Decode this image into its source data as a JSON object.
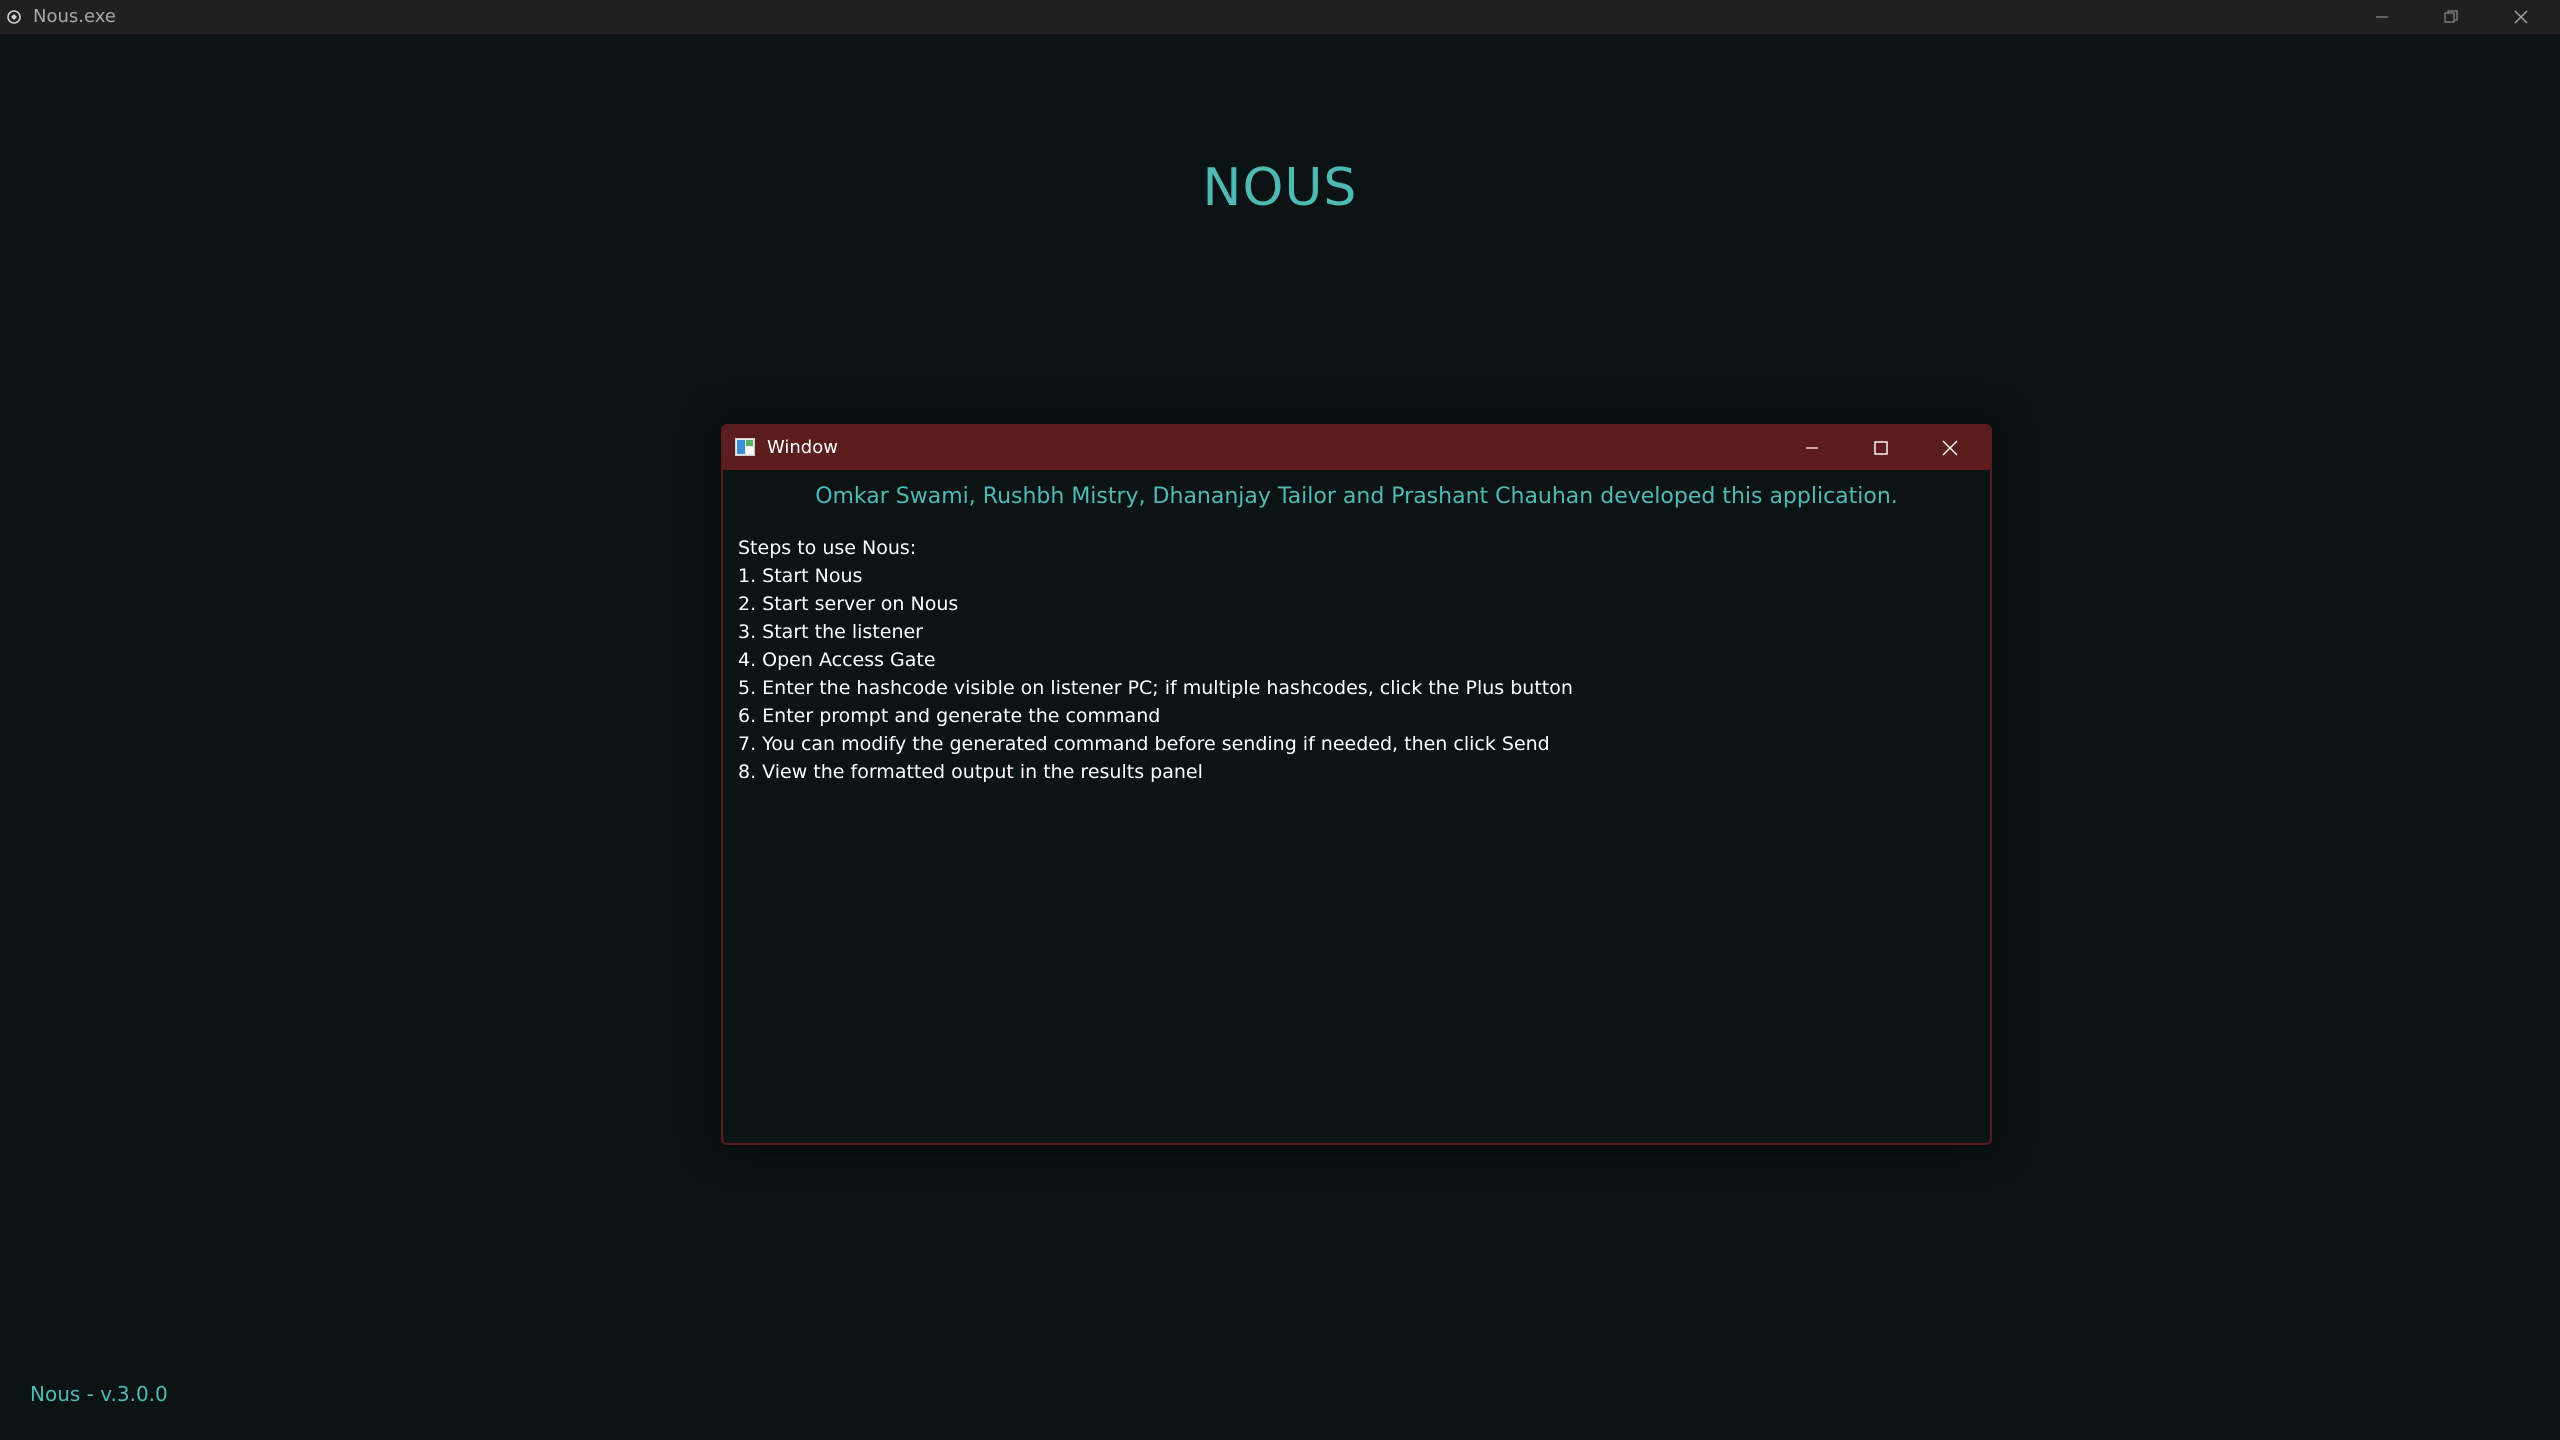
{
  "app_window": {
    "title": "Nous.exe",
    "controls": [
      "minimize",
      "restore",
      "close"
    ]
  },
  "main": {
    "title": "NOUS",
    "version": "Nous - v.3.0.0"
  },
  "dialog": {
    "title": "Window",
    "credits": "Omkar Swami, Rushbh Mistry, Dhananjay Tailor and Prashant Chauhan developed this application.",
    "steps_heading": "Steps to use Nous:",
    "steps": [
      "1. Start Nous",
      "2. Start server on Nous",
      "3. Start the listener",
      "4. Open Access Gate",
      "5. Enter the hashcode visible on listener PC; if multiple hashcodes, click the Plus button",
      "6. Enter prompt and generate the command",
      "7. You can modify the generated command before sending if needed, then click Send",
      "8. View the formatted output in the results panel"
    ]
  },
  "colors": {
    "background": "#0b1315",
    "accent": "#4fbab3",
    "dialog_titlebar": "#5b1d1d",
    "app_titlebar": "#202020"
  }
}
